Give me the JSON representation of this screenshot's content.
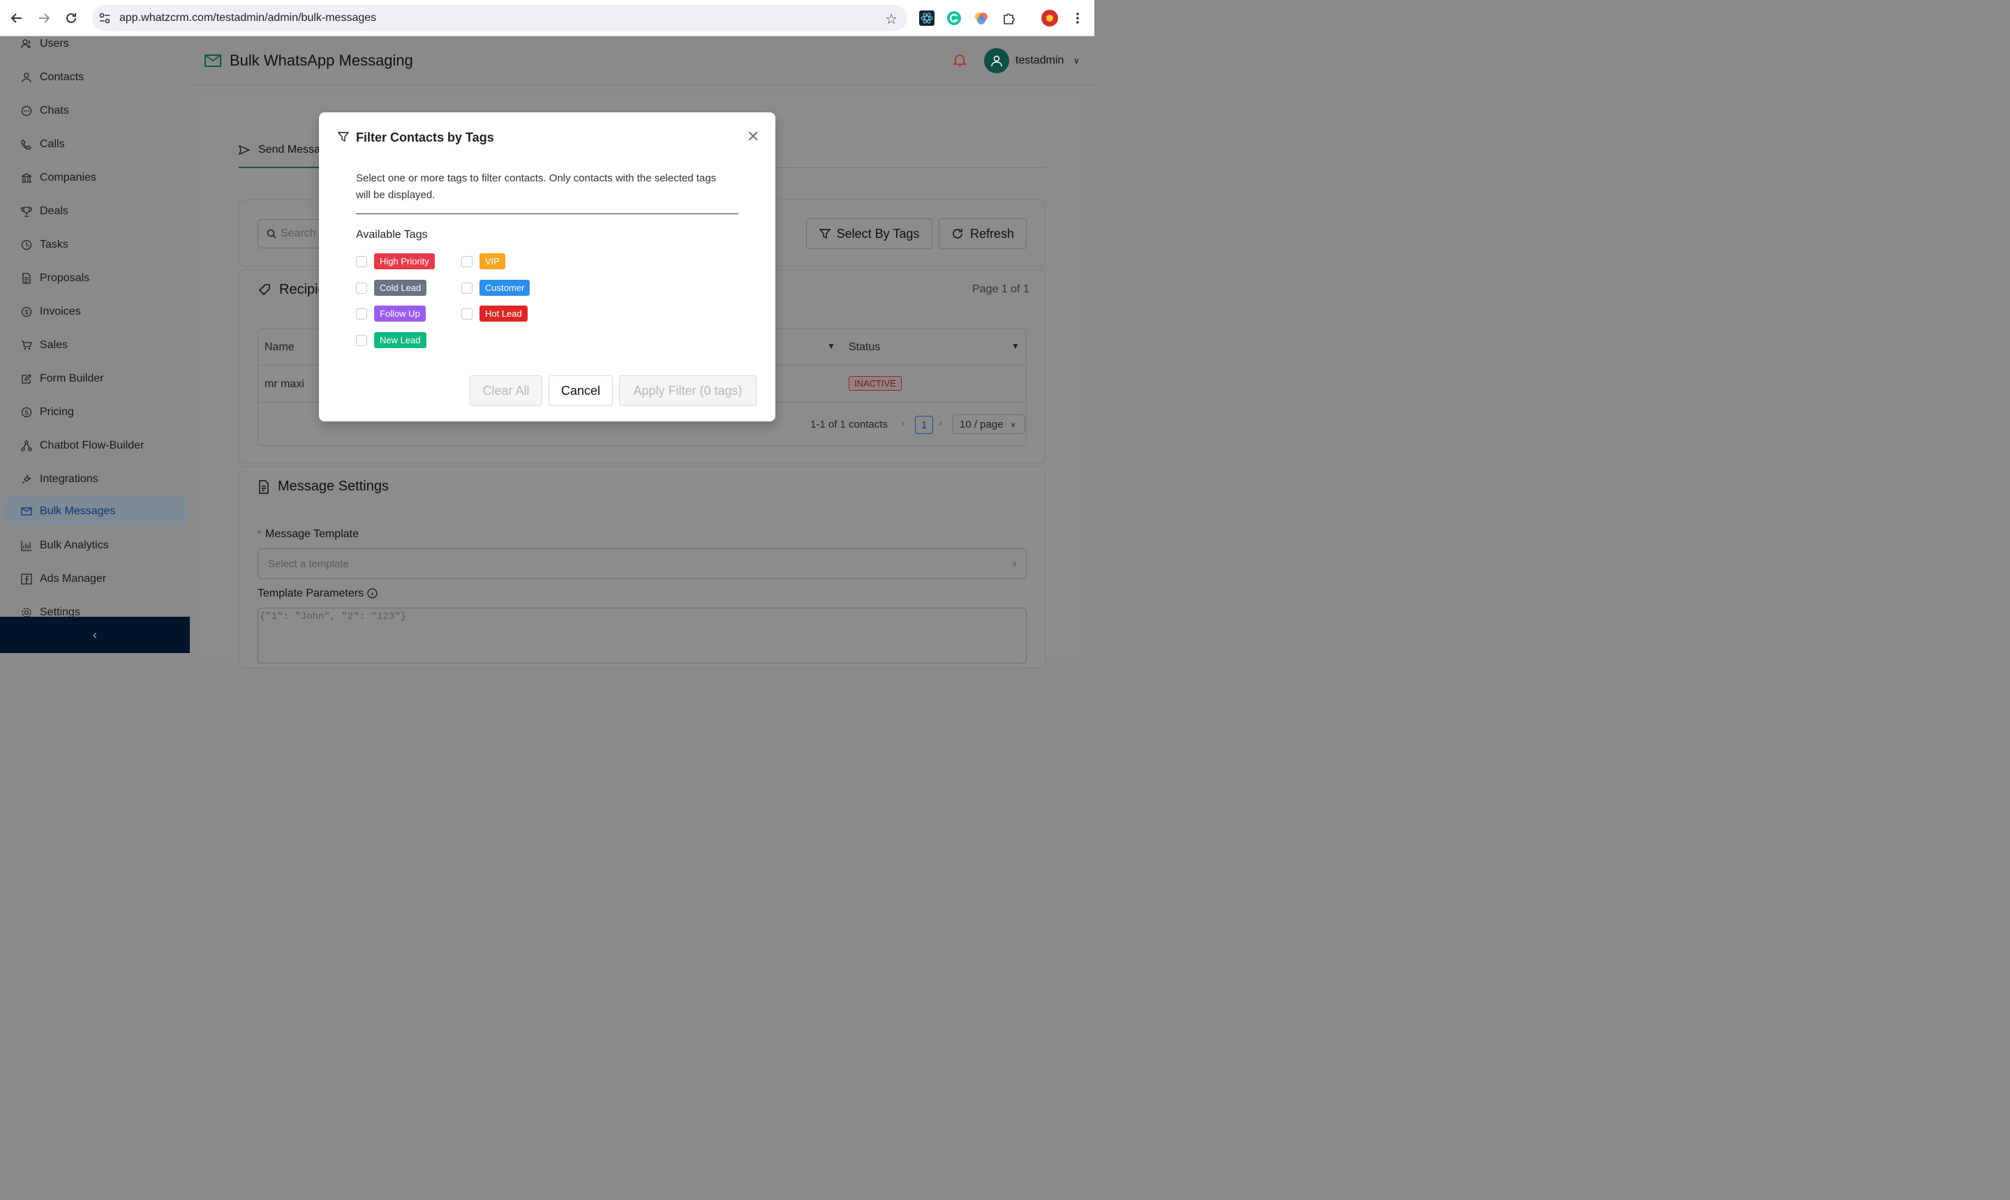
{
  "browser": {
    "url": "app.whatzcrm.com/testadmin/admin/bulk-messages"
  },
  "sidebar": {
    "items": [
      {
        "label": "Users",
        "icon": "users-icon"
      },
      {
        "label": "Contacts",
        "icon": "user-icon"
      },
      {
        "label": "Chats",
        "icon": "chat-icon"
      },
      {
        "label": "Calls",
        "icon": "phone-icon"
      },
      {
        "label": "Companies",
        "icon": "bank-icon"
      },
      {
        "label": "Deals",
        "icon": "trophy-icon"
      },
      {
        "label": "Tasks",
        "icon": "clock-icon"
      },
      {
        "label": "Proposals",
        "icon": "document-icon"
      },
      {
        "label": "Invoices",
        "icon": "dollar-icon"
      },
      {
        "label": "Sales",
        "icon": "cart-icon"
      },
      {
        "label": "Form Builder",
        "icon": "form-icon"
      },
      {
        "label": "Pricing",
        "icon": "dollar-icon"
      },
      {
        "label": "Chatbot Flow-Builder",
        "icon": "flow-icon"
      },
      {
        "label": "Integrations",
        "icon": "plug-icon"
      },
      {
        "label": "Bulk Messages",
        "icon": "mail-icon",
        "active": true
      },
      {
        "label": "Bulk Analytics",
        "icon": "bar-chart-icon"
      },
      {
        "label": "Ads Manager",
        "icon": "facebook-icon"
      },
      {
        "label": "Settings",
        "icon": "gear-icon"
      }
    ]
  },
  "header": {
    "title": "Bulk WhatsApp Messaging",
    "username": "testadmin"
  },
  "main": {
    "tab_send": "Send Messa",
    "search_placeholder": "Search",
    "select_by_tags": "Select By Tags",
    "refresh": "Refresh",
    "recipients_title": "Recipie",
    "page_info": "Page 1 of 1",
    "table": {
      "col_name": "Name",
      "col_status": "Status",
      "rows": [
        {
          "name": "mr maxi",
          "status": "INACTIVE"
        }
      ]
    },
    "pager": {
      "summary": "1-1 of 1 contacts",
      "current": "1",
      "per_page": "10 / page"
    },
    "message_settings": {
      "title": "Message Settings",
      "required_mark": "*",
      "template_label": "Message Template",
      "template_placeholder": "Select a template",
      "params_label": "Template Parameters",
      "params_placeholder": "{\"1\": \"John\", \"2\": \"123\"}"
    }
  },
  "modal": {
    "title": "Filter Contacts by Tags",
    "description": "Select one or more tags to filter contacts. Only contacts with the selected tags will be displayed.",
    "available_label": "Available Tags",
    "tags": [
      {
        "label": "High Priority",
        "color": "#e8394a"
      },
      {
        "label": "VIP",
        "color": "#f5a623"
      },
      {
        "label": "Cold Lead",
        "color": "#6b7280"
      },
      {
        "label": "Customer",
        "color": "#2d8ef0"
      },
      {
        "label": "Follow Up",
        "color": "#9b5cf0"
      },
      {
        "label": "Hot Lead",
        "color": "#dc2626"
      },
      {
        "label": "New Lead",
        "color": "#10b981"
      }
    ],
    "buttons": {
      "clear": "Clear All",
      "cancel": "Cancel",
      "apply": "Apply Filter (0 tags)"
    }
  }
}
